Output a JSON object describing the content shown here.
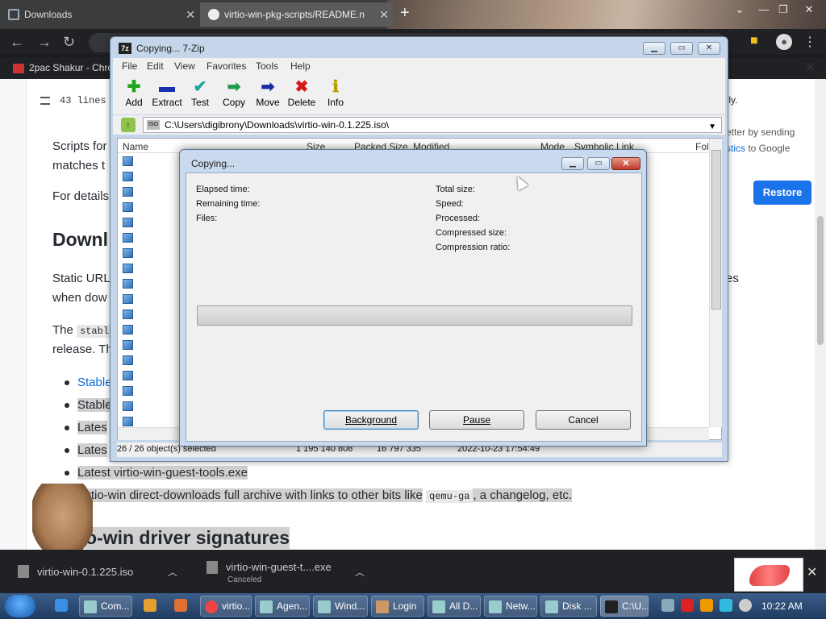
{
  "browser": {
    "tabs": [
      {
        "title": "Downloads",
        "active": false
      },
      {
        "title": "virtio-win-pkg-scripts/README.n",
        "active": true
      }
    ],
    "bookmark": "2pac Shakur - Chro"
  },
  "page": {
    "lines_info": "43 lines",
    "para1_a": "Scripts for",
    "para1_b": "matches t",
    "para2": "For details",
    "heading1": "Downl",
    "para3_a": "Static URL",
    "para3_b": "when dow",
    "para4_a": "The",
    "para4_code": "stabl",
    "para4_b": "release. Th",
    "list_items": [
      "Stable",
      "Stable",
      "Lates",
      "Lates",
      "Latest virtio-win-guest-tools.exe"
    ],
    "list_item6_a": "virtio-win direct-downloads full archive with links to other bits like",
    "list_item6_code": "qemu-ga",
    "list_item6_b": ", a changelog, etc.",
    "heading2": "o-win driver signatures",
    "right_text1": "tly.",
    "right_text2": "etter by sending",
    "right_text3_link": "stics",
    "right_text3_b": "to Google",
    "right_text4": "es",
    "restore_label": "Restore"
  },
  "sevenzip": {
    "title": "Copying... 7-Zip",
    "app_icon": "7z",
    "menu": [
      "File",
      "Edit",
      "View",
      "Favorites",
      "Tools",
      "Help"
    ],
    "tools": [
      {
        "label": "Add",
        "icon": "plus-icon",
        "color": "#1fa51f",
        "glyph": "✚"
      },
      {
        "label": "Extract",
        "icon": "minus-icon",
        "color": "#1a2fb0",
        "glyph": "▬"
      },
      {
        "label": "Test",
        "icon": "check-icon",
        "color": "#1fa5a0",
        "glyph": "✔"
      },
      {
        "label": "Copy",
        "icon": "copy-arrow-icon",
        "color": "#1f9a4a",
        "glyph": "➡"
      },
      {
        "label": "Move",
        "icon": "move-arrow-icon",
        "color": "#1a2aa0",
        "glyph": "➡"
      },
      {
        "label": "Delete",
        "icon": "delete-x-icon",
        "color": "#d21a1a",
        "glyph": "✖"
      },
      {
        "label": "Info",
        "icon": "info-icon",
        "color": "#b5a000",
        "glyph": "ℹ"
      }
    ],
    "path": "C:\\Users\\digibrony\\Downloads\\virtio-win-0.1.225.iso\\",
    "columns": [
      "Name",
      "Size",
      "Packed Size",
      "Modified",
      "Mode",
      "Symbolic Link",
      "Fol"
    ],
    "status": {
      "selected": "26 / 26 object(s) selected",
      "size": "1 195 140 808",
      "packed": "16 797 335",
      "modified": "2022-10-23 17:54:49"
    }
  },
  "dialog": {
    "title": "Copying...",
    "left_labels": [
      "Elapsed time:",
      "Remaining time:",
      "Files:"
    ],
    "right_labels": [
      "Total size:",
      "Speed:",
      "Processed:",
      "Compressed size:",
      "Compression ratio:"
    ],
    "progress": 0,
    "buttons": {
      "background": "Background",
      "pause": "Pause",
      "cancel": "Cancel"
    }
  },
  "downloads": [
    {
      "name": "virtio-win-0.1.225.iso",
      "status": ""
    },
    {
      "name": "virtio-win-guest-t....exe",
      "status": "Canceled"
    }
  ],
  "taskbar": {
    "items": [
      "Com...",
      "virtio...",
      "Agen...",
      "Wind...",
      "Login",
      "All D...",
      "Netw...",
      "Disk ...",
      "C:\\U..."
    ],
    "clock": "10:22 AM"
  }
}
